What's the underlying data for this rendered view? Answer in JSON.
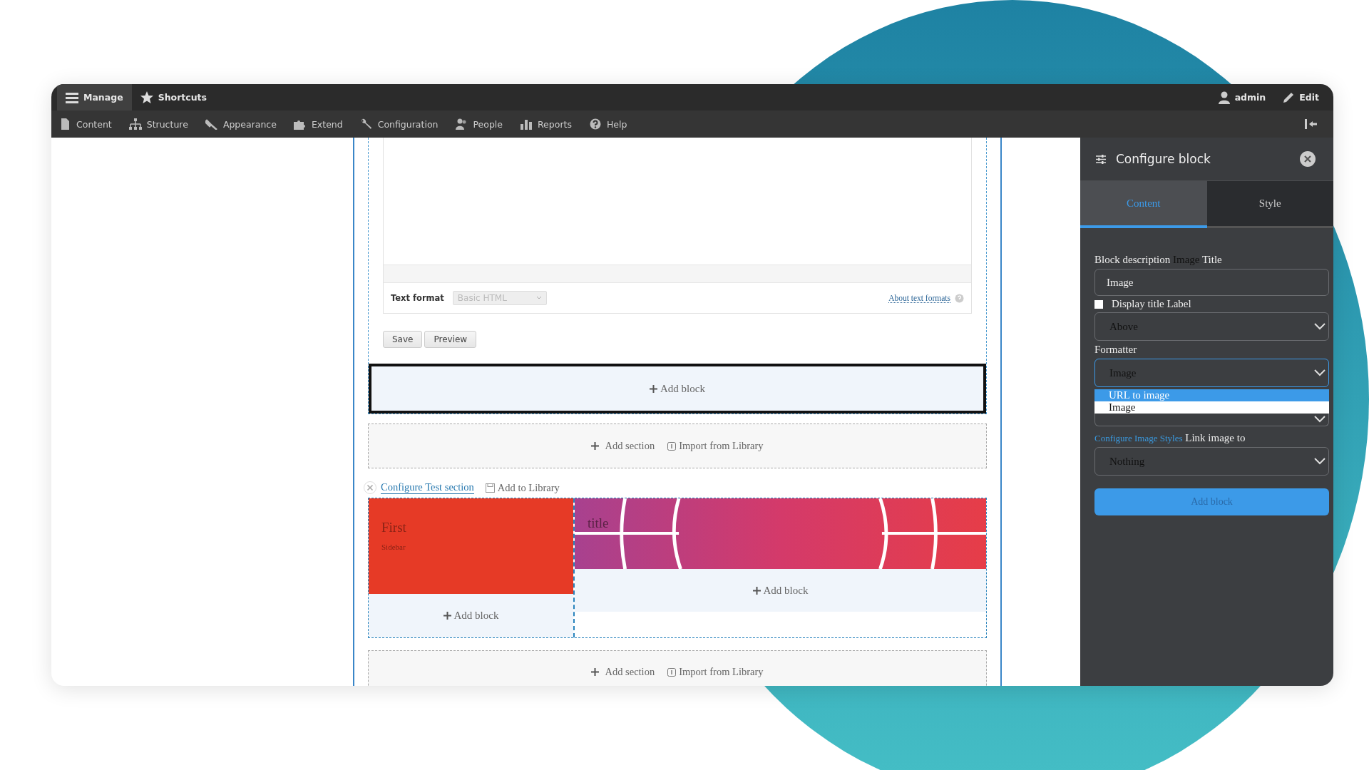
{
  "toolbar": {
    "top_left": [
      {
        "label": "Manage",
        "selected": true
      },
      {
        "label": "Shortcuts",
        "selected": false
      }
    ],
    "top_right": [
      "admin",
      "Edit"
    ],
    "menu": [
      "Content",
      "Structure",
      "Appearance",
      "Extend",
      "Configuration",
      "People",
      "Reports",
      "Help"
    ]
  },
  "editor": {
    "text_format_label": "Text format",
    "text_format_value": "Basic HTML",
    "help_link": "About text formats",
    "buttons": [
      "Save",
      "Preview"
    ]
  },
  "highlighted_block": {
    "label": "Add block"
  },
  "section_actions": {
    "add_section": "Add section",
    "import": "Import from Library"
  },
  "section": {
    "configure_link": "Configure Test section",
    "add_to_library": "Add to Library",
    "first_title": "First",
    "first_subtitle": "Sidebar",
    "left_add_block": "Add block",
    "image_title": "title",
    "right_add_block": "Add block"
  },
  "bottom_section_actions": {
    "add_section": "Add section",
    "import": "Import from Library"
  },
  "sidebar": {
    "title": "Configure block",
    "tabs": [
      {
        "label": "Content",
        "selected": true
      },
      {
        "label": "Style",
        "selected": false
      }
    ],
    "block_description": {
      "label": "Block description",
      "value": "Image",
      "suffix": "Title"
    },
    "title_value": "Image",
    "display_title": {
      "label": "Display title Label",
      "checked": false
    },
    "label_select": "Above",
    "formatter_label": "Formatter",
    "formatter_select": "Image",
    "formatter_options": [
      {
        "label": "URL to image",
        "selected": true
      },
      {
        "label": "Image",
        "selected": false
      }
    ],
    "image_styles_link": "Configure Image Styles",
    "link_label": "Link image to",
    "link_select": "Nothing",
    "submit": "Add block"
  }
}
